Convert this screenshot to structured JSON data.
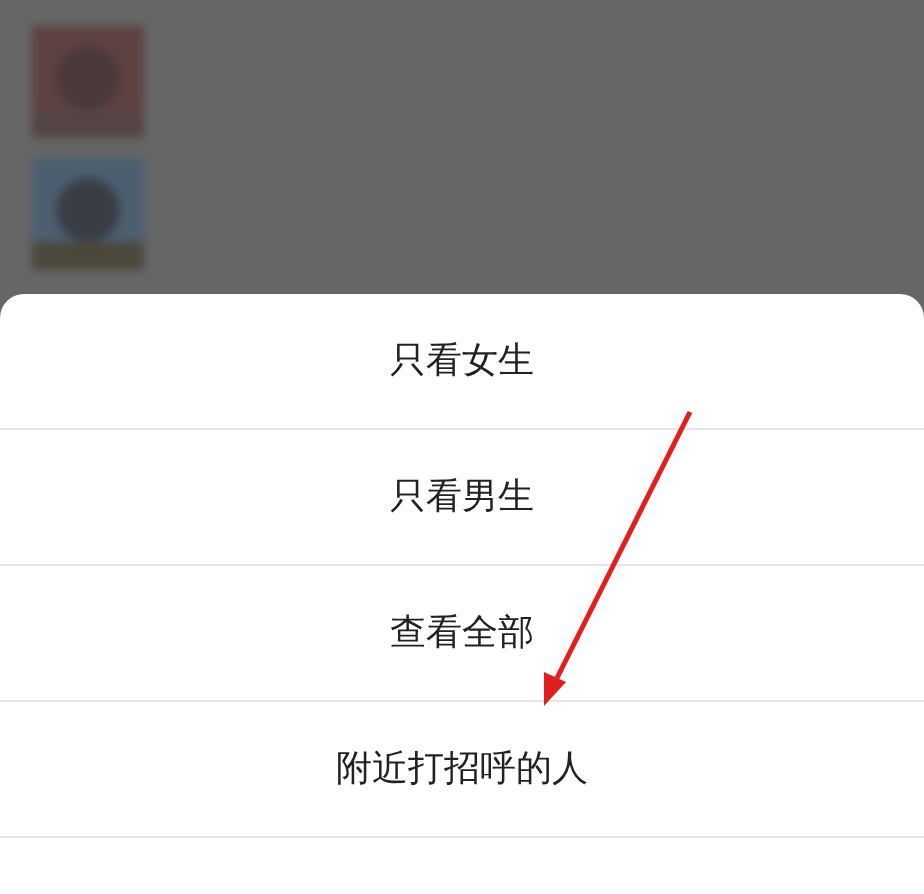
{
  "action_sheet": {
    "options": [
      {
        "label": "只看女生"
      },
      {
        "label": "只看男生"
      },
      {
        "label": "查看全部"
      },
      {
        "label": "附近打招呼的人"
      }
    ]
  }
}
